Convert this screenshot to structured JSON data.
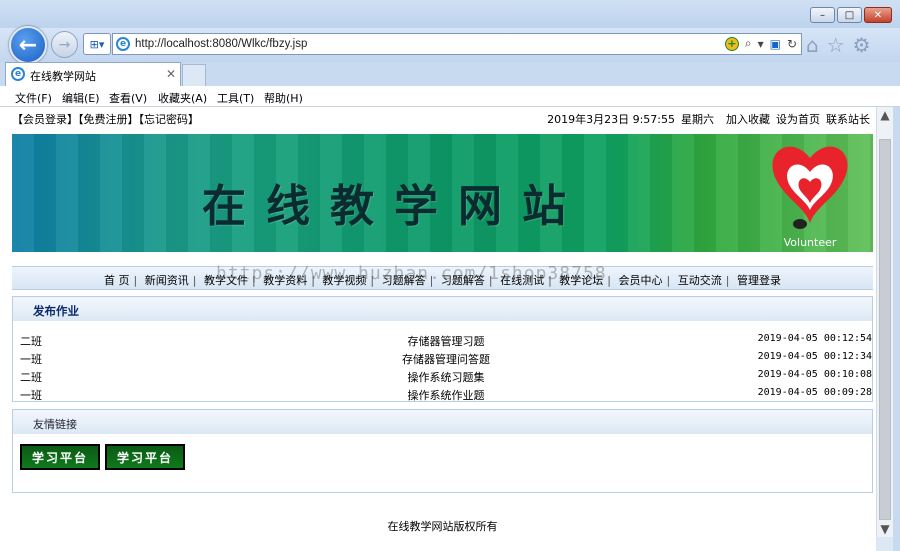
{
  "browser": {
    "url": "http://localhost:8080/Wlkc/fbzy.jsp",
    "tab_title": "在线教学网站",
    "menu": [
      "文件(F)",
      "编辑(E)",
      "查看(V)",
      "收藏夹(A)",
      "工具(T)",
      "帮助(H)"
    ]
  },
  "top_links": {
    "left": "【会员登录】【免费注册】【忘记密码】",
    "datetime": "2019年3月23日  9:57:55",
    "weekday": "星期六",
    "right": [
      "加入收藏",
      "设为首页",
      "联系站长"
    ]
  },
  "banner": {
    "title": "在线教学网站",
    "logo_text": "Volunteer"
  },
  "nav": [
    "首 页",
    "新闻资讯",
    "教学文件",
    "教学资料",
    "教学视频",
    "习题解答",
    "习题解答",
    "在线测试",
    "教学论坛",
    "会员中心",
    "互动交流",
    "管理登录"
  ],
  "watermark": "https://www.huzhan.com/1shop38758",
  "homework": {
    "section_title": "发布作业",
    "rows": [
      {
        "class": "二班",
        "title": "存储器管理习题",
        "time": "2019-04-05 00:12:54"
      },
      {
        "class": "一班",
        "title": "存储器管理问答题",
        "time": "2019-04-05 00:12:34"
      },
      {
        "class": "二班",
        "title": "操作系统习题集",
        "time": "2019-04-05 00:10:08"
      },
      {
        "class": "一班",
        "title": "操作系统作业题",
        "time": "2019-04-05 00:09:28"
      }
    ]
  },
  "links": {
    "section_title": "友情链接",
    "items": [
      "学习平台",
      "学习平台"
    ]
  },
  "footer": "在线教学网站版权所有"
}
